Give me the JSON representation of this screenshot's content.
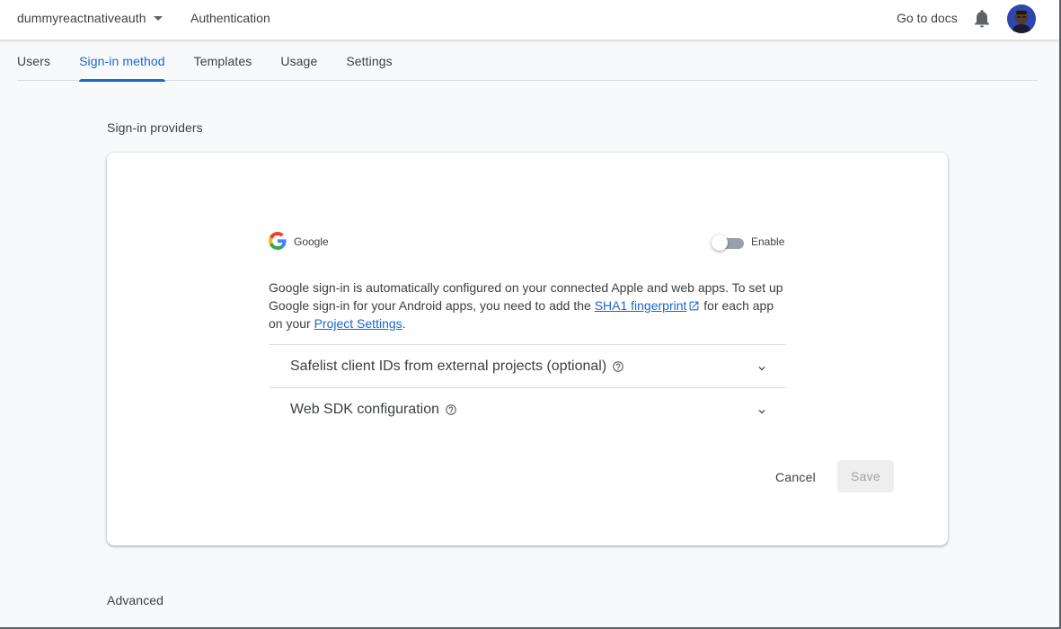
{
  "topbar": {
    "project_name": "dummyreactnativeauth",
    "section_title": "Authentication",
    "docs_link": "Go to docs"
  },
  "tabs": [
    {
      "label": "Users"
    },
    {
      "label": "Sign-in method",
      "active": true
    },
    {
      "label": "Templates"
    },
    {
      "label": "Usage"
    },
    {
      "label": "Settings"
    }
  ],
  "providers_heading": "Sign-in providers",
  "provider": {
    "name": "Google",
    "toggle_label": "Enable",
    "enabled": false,
    "description_part1": "Google sign-in is automatically configured on your connected Apple and web apps. To set up Google sign-in for your Android apps, you need to add the ",
    "sha1_link": "SHA1 fingerprint",
    "description_part2": " for each app on your ",
    "project_settings_link": "Project Settings",
    "description_part3": "."
  },
  "expanders": [
    {
      "title": "Safelist client IDs from external projects (optional)"
    },
    {
      "title": "Web SDK configuration"
    }
  ],
  "actions": {
    "cancel_label": "Cancel",
    "save_label": "Save"
  },
  "advanced_heading": "Advanced",
  "colors": {
    "accent": "#1967d2",
    "text": "#3c4043",
    "background": "#f8f9fa"
  }
}
